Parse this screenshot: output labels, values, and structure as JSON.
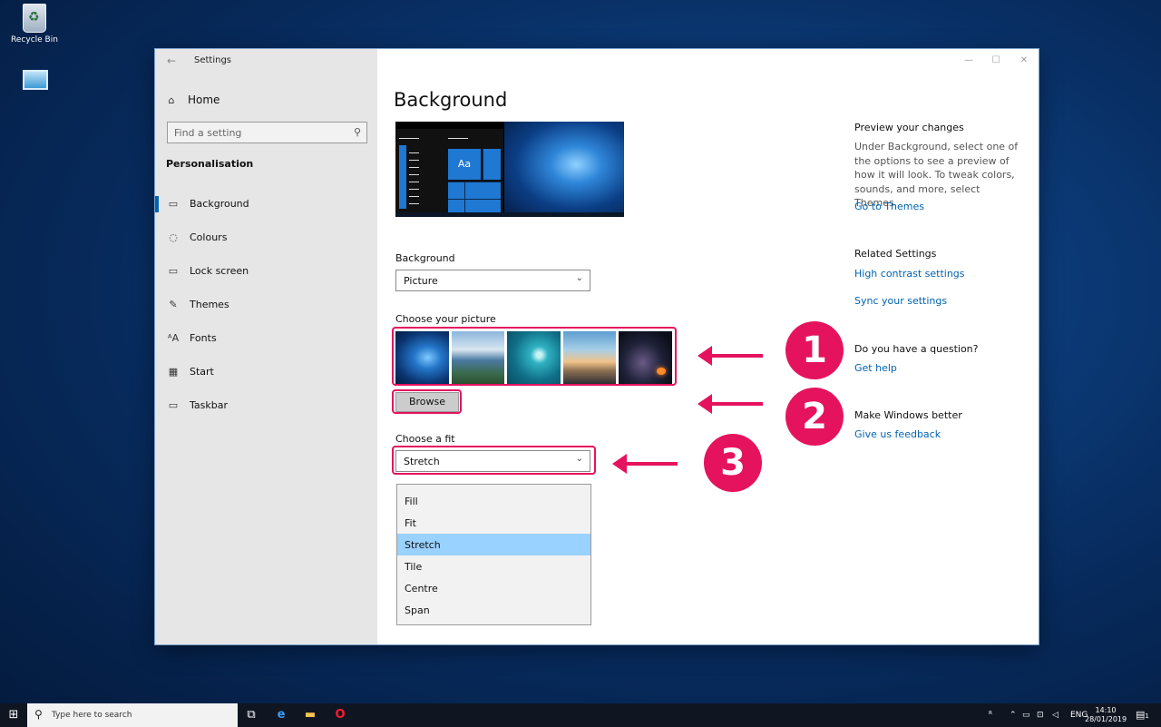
{
  "desktop": {
    "recycle_bin_label": "Recycle Bin",
    "control_panel_icon": "control-panel-icon"
  },
  "window": {
    "title": "Settings",
    "back_icon": "back-arrow-icon",
    "minimize_glyph": "—",
    "maximize_glyph": "☐",
    "close_glyph": "✕"
  },
  "sidebar": {
    "home_label": "Home",
    "search_placeholder": "Find a setting",
    "section_label": "Personalisation",
    "items": [
      {
        "label": "Background",
        "icon": "picture-icon",
        "glyph": "▭",
        "active": true
      },
      {
        "label": "Colours",
        "icon": "palette-icon",
        "glyph": "◌",
        "active": false
      },
      {
        "label": "Lock screen",
        "icon": "lock-screen-icon",
        "glyph": "▭",
        "active": false
      },
      {
        "label": "Themes",
        "icon": "brush-icon",
        "glyph": "✎",
        "active": false
      },
      {
        "label": "Fonts",
        "icon": "fonts-icon",
        "glyph": "ᴬA",
        "active": false
      },
      {
        "label": "Start",
        "icon": "start-icon",
        "glyph": "▦",
        "active": false
      },
      {
        "label": "Taskbar",
        "icon": "taskbar-icon",
        "glyph": "▭",
        "active": false
      }
    ]
  },
  "main": {
    "title": "Background",
    "preview_tile_label": "Aa",
    "background_label": "Background",
    "background_value": "Picture",
    "choose_picture_label": "Choose your picture",
    "browse_label": "Browse",
    "choose_fit_label": "Choose a fit",
    "fit_value": "Stretch",
    "fit_options": [
      "Fill",
      "Fit",
      "Stretch",
      "Tile",
      "Centre",
      "Span"
    ],
    "fit_selected": "Stretch"
  },
  "right_panel": {
    "preview_heading": "Preview your changes",
    "preview_text": "Under Background, select one of the options to see a preview of how it will look. To tweak colors, sounds, and more, select Themes.",
    "themes_link": "Go to Themes",
    "related_heading": "Related Settings",
    "high_contrast_link": "High contrast settings",
    "sync_link": "Sync your settings",
    "question_heading": "Do you have a question?",
    "help_link": "Get help",
    "better_heading": "Make Windows better",
    "feedback_link": "Give us feedback"
  },
  "annotations": {
    "step1": "1",
    "step2": "2",
    "step3": "3",
    "color": "#e5135e"
  },
  "taskbar": {
    "search_placeholder": "Type here to search",
    "language": "ENG",
    "time": "14:10",
    "date": "28/01/2019",
    "notification_count": "1"
  },
  "colors": {
    "accent": "#0063b1",
    "sidebar_bg": "#e6e6e6",
    "selected_item": "#99d1ff"
  }
}
